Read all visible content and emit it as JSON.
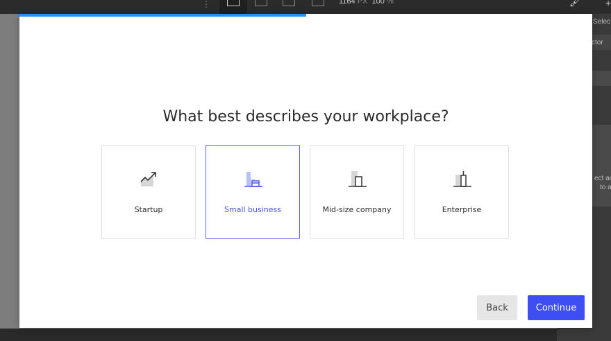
{
  "editor": {
    "dims_px": "1164",
    "dims_unit": "PX",
    "zoom": "100",
    "zoom_unit": "%",
    "panel_select": "Selec",
    "panel_selector": "ctor",
    "panel_hint_line1": "ect an",
    "panel_hint_line2": "to a"
  },
  "modal": {
    "progress_fraction": 0.5,
    "question": "What best describes your workplace?",
    "options": [
      {
        "label": "Startup",
        "icon": "trending-up-icon",
        "selected": false
      },
      {
        "label": "Small business",
        "icon": "storefront-icon",
        "selected": true
      },
      {
        "label": "Mid-size company",
        "icon": "building-icon",
        "selected": false
      },
      {
        "label": "Enterprise",
        "icon": "skyscraper-icon",
        "selected": false
      }
    ],
    "back_label": "Back",
    "continue_label": "Continue"
  },
  "colors": {
    "accent": "#3d4ff2",
    "progress": "#2f8cf0",
    "selected_border": "#5b63ee"
  }
}
